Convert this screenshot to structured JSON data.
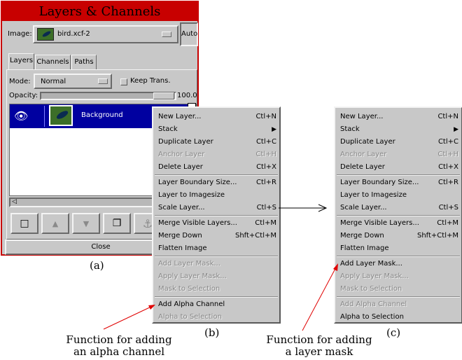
{
  "dialog": {
    "title": "Layers & Channels",
    "image_label": "Image:",
    "image_value": "bird.xcf-2",
    "auto_label": "Auto",
    "tabs": [
      {
        "label": "Layers",
        "active": true
      },
      {
        "label": "Channels",
        "active": false
      },
      {
        "label": "Paths",
        "active": false
      }
    ],
    "mode_label": "Mode:",
    "mode_value": "Normal",
    "keep_trans_label": "Keep Trans.",
    "keep_trans_checked": false,
    "opacity_label": "Opacity:",
    "opacity_value": "100.0",
    "opacity_fraction": 1.0,
    "layers": [
      {
        "name": "Background",
        "visible": true,
        "selected": true
      }
    ],
    "toolbar_icons": [
      "new-layer-icon",
      "raise-layer-icon",
      "lower-layer-icon",
      "duplicate-layer-icon",
      "anchor-icon"
    ],
    "close_label": "Close"
  },
  "menu_b": {
    "items": [
      {
        "label": "New Layer...",
        "shortcut": "Ctl+N",
        "enabled": true
      },
      {
        "label": "Stack",
        "shortcut": "",
        "enabled": true,
        "submenu": true
      },
      {
        "label": "Duplicate Layer",
        "shortcut": "Ctl+C",
        "enabled": true
      },
      {
        "label": "Anchor Layer",
        "shortcut": "Ctl+H",
        "enabled": false
      },
      {
        "label": "Delete Layer",
        "shortcut": "Ctl+X",
        "enabled": true
      },
      {
        "sep": true
      },
      {
        "label": "Layer Boundary Size...",
        "shortcut": "Ctl+R",
        "enabled": true
      },
      {
        "label": "Layer to Imagesize",
        "shortcut": "",
        "enabled": true
      },
      {
        "label": "Scale Layer...",
        "shortcut": "Ctl+S",
        "enabled": true
      },
      {
        "sep": true
      },
      {
        "label": "Merge Visible Layers...",
        "shortcut": "Ctl+M",
        "enabled": true
      },
      {
        "label": "Merge Down",
        "shortcut": "Shft+Ctl+M",
        "enabled": true
      },
      {
        "label": "Flatten Image",
        "shortcut": "",
        "enabled": true
      },
      {
        "sep": true
      },
      {
        "label": "Add Layer Mask...",
        "shortcut": "",
        "enabled": false
      },
      {
        "label": "Apply Layer Mask...",
        "shortcut": "",
        "enabled": false
      },
      {
        "label": "Mask to Selection",
        "shortcut": "",
        "enabled": false
      },
      {
        "sep": true
      },
      {
        "label": "Add Alpha Channel",
        "shortcut": "",
        "enabled": true
      },
      {
        "label": "Alpha to Selection",
        "shortcut": "",
        "enabled": false
      }
    ]
  },
  "menu_c": {
    "items": [
      {
        "label": "New Layer...",
        "shortcut": "Ctl+N",
        "enabled": true
      },
      {
        "label": "Stack",
        "shortcut": "",
        "enabled": true,
        "submenu": true
      },
      {
        "label": "Duplicate Layer",
        "shortcut": "Ctl+C",
        "enabled": true
      },
      {
        "label": "Anchor Layer",
        "shortcut": "Ctl+H",
        "enabled": false
      },
      {
        "label": "Delete Layer",
        "shortcut": "Ctl+X",
        "enabled": true
      },
      {
        "sep": true
      },
      {
        "label": "Layer Boundary Size...",
        "shortcut": "Ctl+R",
        "enabled": true
      },
      {
        "label": "Layer to Imagesize",
        "shortcut": "",
        "enabled": true
      },
      {
        "label": "Scale Layer...",
        "shortcut": "Ctl+S",
        "enabled": true
      },
      {
        "sep": true
      },
      {
        "label": "Merge Visible Layers...",
        "shortcut": "Ctl+M",
        "enabled": true
      },
      {
        "label": "Merge Down",
        "shortcut": "Shft+Ctl+M",
        "enabled": true
      },
      {
        "label": "Flatten Image",
        "shortcut": "",
        "enabled": true
      },
      {
        "sep": true
      },
      {
        "label": "Add Layer Mask...",
        "shortcut": "",
        "enabled": true
      },
      {
        "label": "Apply Layer Mask...",
        "shortcut": "",
        "enabled": false
      },
      {
        "label": "Mask to Selection",
        "shortcut": "",
        "enabled": false
      },
      {
        "sep": true
      },
      {
        "label": "Add Alpha Channel",
        "shortcut": "",
        "enabled": false
      },
      {
        "label": "Alpha to Selection",
        "shortcut": "",
        "enabled": true
      }
    ]
  },
  "captions": {
    "a": "(a)",
    "b": "(b)",
    "c": "(c)"
  },
  "annotations": {
    "alpha_line1": "Function for adding",
    "alpha_line2": "an alpha channel",
    "mask_line1": "Function for adding",
    "mask_line2": "a layer mask"
  },
  "colors": {
    "title_bar": "#c80000",
    "selection": "#0000a0",
    "annotation_arrow": "#e00000",
    "panel": "#c8c8c8"
  }
}
